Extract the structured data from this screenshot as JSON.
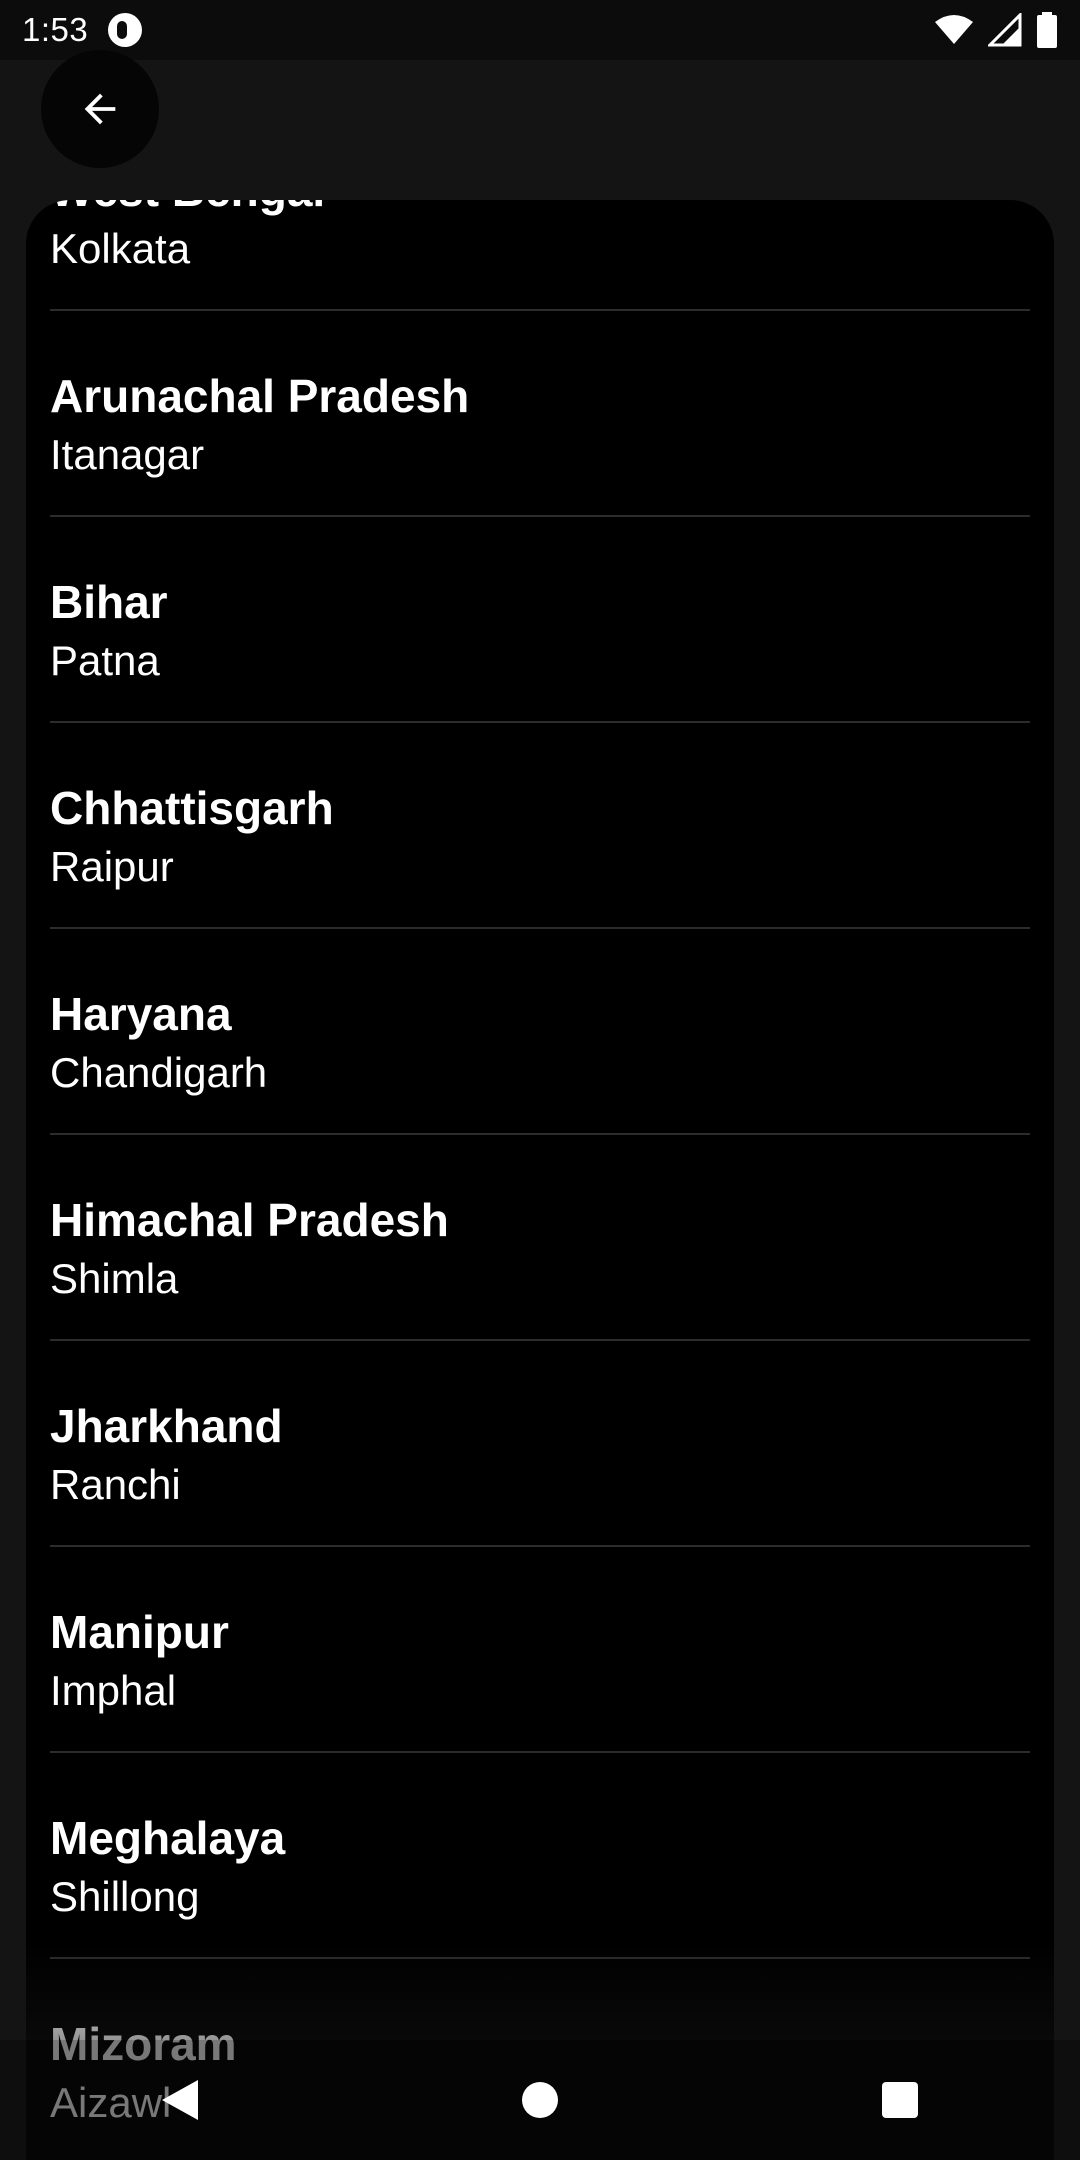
{
  "status_bar": {
    "time": "1:53",
    "icons": [
      "notification-icon",
      "wifi-icon",
      "signal-icon",
      "battery-icon"
    ]
  },
  "app_bar": {
    "back_icon": "arrow-back-icon"
  },
  "list": {
    "items": [
      {
        "state": "West Bengal",
        "capital": "Kolkata"
      },
      {
        "state": "Arunachal Pradesh",
        "capital": "Itanagar"
      },
      {
        "state": "Bihar",
        "capital": "Patna"
      },
      {
        "state": "Chhattisgarh",
        "capital": "Raipur"
      },
      {
        "state": "Haryana",
        "capital": "Chandigarh"
      },
      {
        "state": "Himachal Pradesh",
        "capital": "Shimla"
      },
      {
        "state": "Jharkhand",
        "capital": "Ranchi"
      },
      {
        "state": "Manipur",
        "capital": "Imphal"
      },
      {
        "state": "Meghalaya",
        "capital": "Shillong"
      },
      {
        "state": "Mizoram",
        "capital": "Aizawl"
      }
    ]
  },
  "nav_bar": {
    "icons": [
      "back-triangle-icon",
      "home-circle-icon",
      "recents-square-icon"
    ]
  },
  "colors": {
    "background": "#141414",
    "card": "#000000",
    "divider": "#2c2c2c",
    "text": "#ffffff"
  }
}
